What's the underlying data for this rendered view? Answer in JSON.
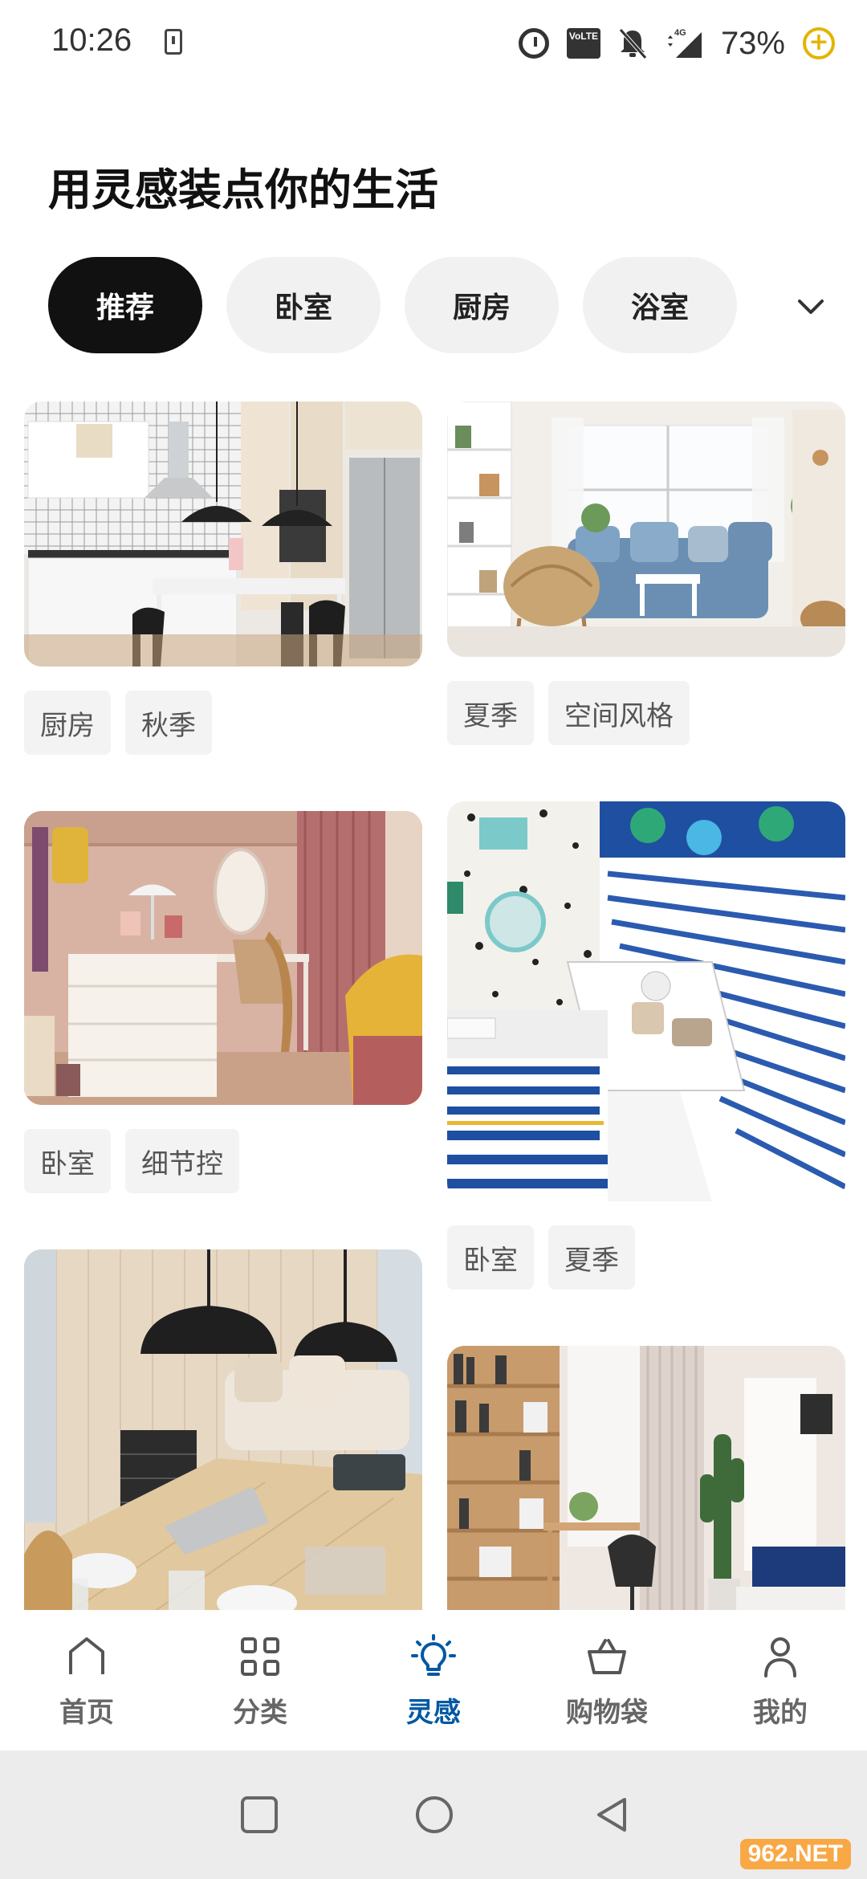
{
  "status_bar": {
    "time": "10:26",
    "network": "4G",
    "volte": "VoLTE",
    "battery": "73%"
  },
  "page": {
    "title": "用灵感装点你的生活"
  },
  "chips": [
    {
      "label": "推荐",
      "active": true
    },
    {
      "label": "卧室",
      "active": false
    },
    {
      "label": "厨房",
      "active": false
    },
    {
      "label": "浴室",
      "active": false
    }
  ],
  "feed": {
    "cards": [
      {
        "scene": "kitchen-photo",
        "tags": [
          "厨房",
          "秋季"
        ]
      },
      {
        "scene": "living-room-photo",
        "tags": [
          "夏季",
          "空间风格"
        ]
      },
      {
        "scene": "vanity-bedroom-photo",
        "tags": [
          "卧室",
          "细节控"
        ]
      },
      {
        "scene": "kids-bedroom-photo",
        "tags": [
          "卧室",
          "夏季"
        ]
      },
      {
        "scene": "dining-room-photo",
        "tags": []
      },
      {
        "scene": "study-bedroom-photo",
        "tags": []
      }
    ]
  },
  "bottom_nav": [
    {
      "label": "首页",
      "icon": "home-icon",
      "active": false
    },
    {
      "label": "分类",
      "icon": "category-icon",
      "active": false
    },
    {
      "label": "灵感",
      "icon": "lightbulb-icon",
      "active": true
    },
    {
      "label": "购物袋",
      "icon": "shopping-bag-icon",
      "active": false
    },
    {
      "label": "我的",
      "icon": "profile-icon",
      "active": false
    }
  ],
  "colors": {
    "accent": "#0058a3",
    "chip_active": "#111111",
    "chip_inactive": "#f1f1f1"
  },
  "watermark": "962.NET"
}
